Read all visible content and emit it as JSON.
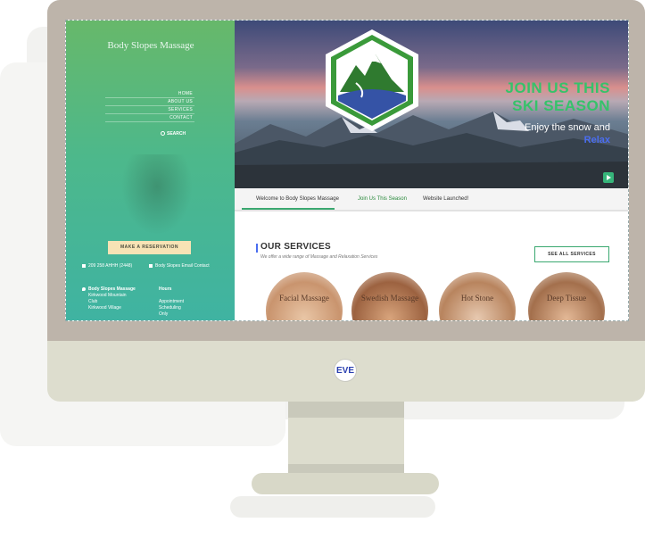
{
  "sidebar": {
    "brand": "Body Slopes Massage",
    "nav": [
      "HOME",
      "ABOUT US",
      "SERVICES",
      "CONTACT"
    ],
    "search_label": "SEARCH",
    "reserve_button": "MAKE A RESERVATION",
    "phone": "209 258 AHHH (2448)",
    "email": "Body Slopes Email Contact",
    "location_title": "Body Slopes Massage",
    "location_lines": [
      "Kirkwood Mountain",
      "Club",
      "Kirkwood Village"
    ],
    "hours_title": "Hours",
    "hours_lines": [
      "Appointment",
      "Scheduling",
      "Only"
    ]
  },
  "hero": {
    "headline_1": "JOIN US THIS",
    "headline_2": "SKI SEASON",
    "subline": "Enjoy the snow and",
    "relax": "Relax"
  },
  "tabs": [
    "Welcome to Body Slopes Massage",
    "Join Us This Season",
    "Website Launched!"
  ],
  "services": {
    "title": "OUR SERVICES",
    "subtitle": "We offer a wide range of Massage and Relaxation Services",
    "see_all": "SEE ALL SERVICES",
    "items": [
      "Facial Massage",
      "Swedish Massage",
      "Hot Stone",
      "Deep Tissue"
    ]
  },
  "colors": {
    "accent_green": "#36c26a",
    "accent_blue": "#4a6df0",
    "sidebar_green": "#4db88b",
    "monitor_frame": "#bdb4aa"
  },
  "icons": [
    "search-icon",
    "phone-icon",
    "email-icon",
    "location-icon",
    "play-icon",
    "brand-logo-icon",
    "mountain-shield-logo"
  ]
}
